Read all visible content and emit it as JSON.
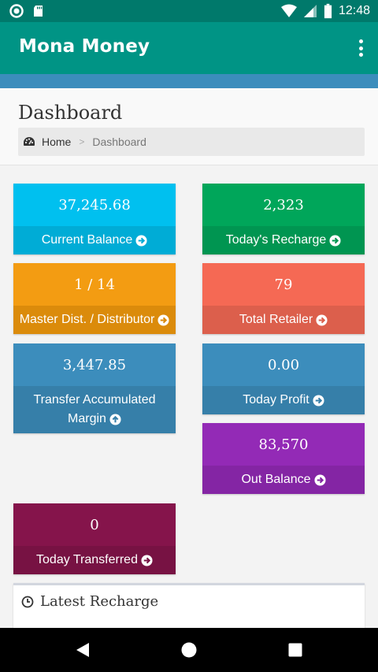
{
  "status_bar": {
    "time": "12:48"
  },
  "app_bar": {
    "title": "Mona Money"
  },
  "header": {
    "title": "Dashboard",
    "breadcrumb": {
      "home": "Home",
      "separator": ">",
      "current": "Dashboard"
    }
  },
  "cards": [
    {
      "value": "37,245.68",
      "label": "Current Balance",
      "color": "#00c0ef",
      "footer_color": "#00acd6"
    },
    {
      "value": "2,323",
      "label": "Today's Recharge",
      "color": "#00a65a",
      "footer_color": "#009551"
    },
    {
      "value": "1 / 14",
      "label": "Master Dist. / Distributor",
      "color": "#f39c12",
      "footer_color": "#db8b0b"
    },
    {
      "value": "79",
      "label": "Total Retailer",
      "color": "#f56954",
      "footer_color": "#dc5f4c"
    },
    {
      "value": "3,447.85",
      "label_line1": "Transfer Accumulated",
      "label_line2": "Margin",
      "color": "#3c8dbc",
      "footer_color": "#367fa9"
    },
    {
      "value": "0.00",
      "label": "Today Profit",
      "color": "#3c8dbc",
      "footer_color": "#367fa9"
    },
    {
      "value": "83,570",
      "label": "Out Balance",
      "color": "#932ab6",
      "footer_color": "#8425a4"
    },
    {
      "value": "0",
      "label": "Today Transferred",
      "color": "#85144b",
      "footer_color": "#771243"
    }
  ],
  "latest_recharge": {
    "title": "Latest Recharge"
  },
  "icons": {
    "card_arrow": "arrow-circle-right-icon",
    "margin_arrow": "arrow-circle-up-icon",
    "home": "dashboard-gauge-icon",
    "latest": "clock-icon"
  }
}
